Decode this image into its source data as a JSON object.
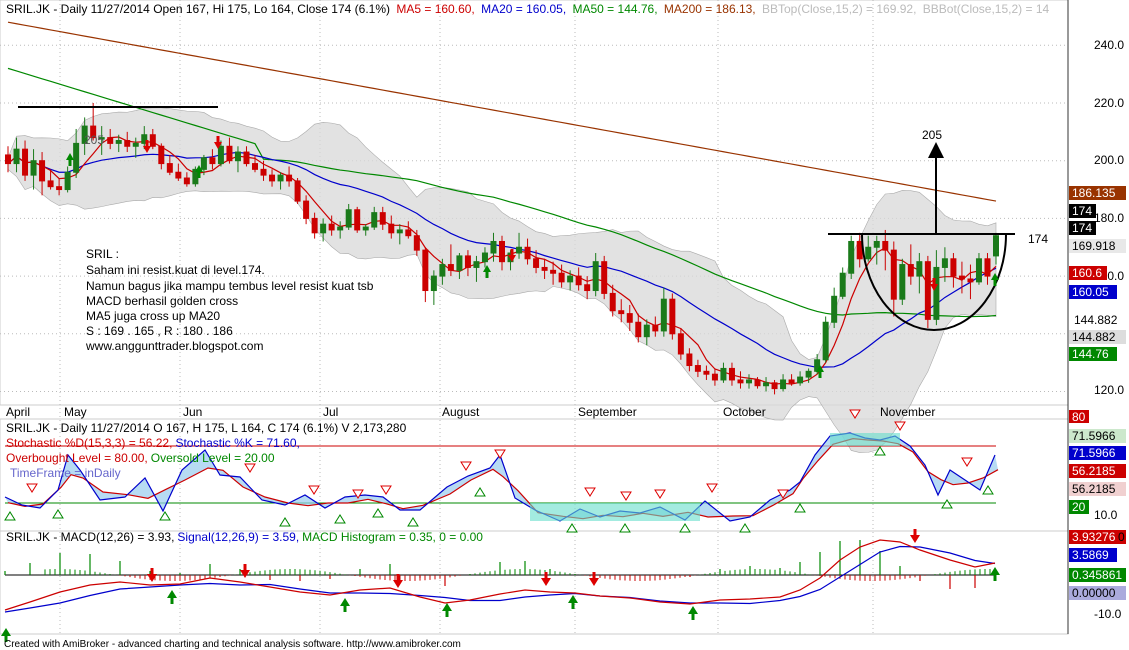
{
  "header": {
    "symbol": "SRIL.JK",
    "desc": " - Daily 11/27/2014 Open 167, Hi 175, Lo 164, Close 174 (6.1%)",
    "ma5": "MA5 = 160.60,",
    "ma20": "MA20 = 160.05,",
    "ma50": "MA50 = 144.76,",
    "ma200": "MA200 = 186.13,",
    "bbtop": "BBTop(Close,15,2) = 169.92,",
    "bbbot": "BBBot(Close,15,2) = 14"
  },
  "colors": {
    "up": "#1a7a1a",
    "down": "#cc0000",
    "ma5": "#cc0000",
    "ma20": "#0000cc",
    "ma50": "#008800",
    "ma200": "#993300",
    "band": "#d8d8d8",
    "histo": "#aaaaaa"
  },
  "price_axis": {
    "ticks": [
      "240.0",
      "220.0",
      "200.0",
      "180.0",
      "160.0",
      "144.882",
      "120.0"
    ],
    "tags": [
      "186.135",
      "174",
      "174",
      "169.918",
      "160.6",
      "160.05",
      "144.882",
      "144.76"
    ]
  },
  "months": [
    "April",
    "May",
    "Jun",
    "Jul",
    "August",
    "September",
    "October",
    "November"
  ],
  "annotations": {
    "resist_label": "205",
    "resist_low": "174",
    "old_top": "205",
    "note_lines": [
      "SRIL :",
      "Saham ini resist.kuat di level.174.",
      "Namun bagus jika mampu tembus level resist kuat tsb",
      "MACD berhasil golden cross",
      "MA5 juga cross up MA20",
      "S : 169 . 165 , R : 180 . 186",
      "www.anggunttrader.blogspot.com"
    ]
  },
  "stoch": {
    "header1": "SRIL.JK - Daily 11/27/2014 O 167, H 175, L 164, C 174 (6.1%) V 2,173,280",
    "d_label": "Stochastic %D(15,3,3) = 56.22,",
    "k_label": "Stochastic %K = 71.60,",
    "ob_label": "Overbought Level = 80.00,",
    "os_label": "Oversold Level = 20.00",
    "tf_label": "TimeFrame = inDaily",
    "ticks": [
      "80",
      "10.0"
    ],
    "tags": [
      "71.5966",
      "71.5966",
      "56.2185",
      "56.2185",
      "20"
    ]
  },
  "macd": {
    "header": "SRIL.JK - MACD(12,26) = 3.93,",
    "signal_label": "Signal(12,26,9) = 3.59,",
    "hist_label": "MACD Histogram = 0.35, 0 = 0.00",
    "ticks": [
      "0",
      "-10.0"
    ],
    "tags": [
      "3.93276",
      "3.5869",
      "0.345861",
      "0.00000"
    ]
  },
  "footer": "Created with AmiBroker - advanced charting and technical analysis software. http://www.amibroker.com",
  "chart_data": {
    "type": "candlestick",
    "title": "SRIL.JK - Daily",
    "ylim": [
      115,
      250
    ],
    "grid": true,
    "candles": [
      [
        202,
        205,
        196,
        199
      ],
      [
        199,
        208,
        196,
        204
      ],
      [
        204,
        207,
        193,
        195
      ],
      [
        195,
        204,
        190,
        200
      ],
      [
        200,
        203,
        188,
        193
      ],
      [
        193,
        197,
        190,
        191
      ],
      [
        191,
        194,
        188,
        190
      ],
      [
        190,
        198,
        189,
        196
      ],
      [
        196,
        211,
        194,
        206
      ],
      [
        206,
        215,
        202,
        212
      ],
      [
        212,
        220,
        207,
        208
      ],
      [
        208,
        212,
        202,
        208
      ],
      [
        208,
        211,
        204,
        206
      ],
      [
        206,
        209,
        203,
        207
      ],
      [
        207,
        210,
        203,
        205
      ],
      [
        205,
        208,
        201,
        206
      ],
      [
        206,
        212,
        204,
        209
      ],
      [
        209,
        211,
        204,
        205
      ],
      [
        205,
        206,
        197,
        199
      ],
      [
        199,
        202,
        195,
        196
      ],
      [
        196,
        199,
        193,
        194
      ],
      [
        194,
        196,
        191,
        192
      ],
      [
        192,
        198,
        191,
        197
      ],
      [
        197,
        202,
        195,
        201
      ],
      [
        201,
        204,
        197,
        199
      ],
      [
        199,
        207,
        198,
        205
      ],
      [
        205,
        208,
        199,
        200
      ],
      [
        200,
        205,
        196,
        203
      ],
      [
        203,
        205,
        198,
        199
      ],
      [
        199,
        202,
        196,
        197
      ],
      [
        197,
        200,
        193,
        195
      ],
      [
        195,
        197,
        191,
        193
      ],
      [
        193,
        196,
        190,
        195
      ],
      [
        195,
        198,
        191,
        193
      ],
      [
        193,
        194,
        185,
        186
      ],
      [
        186,
        188,
        178,
        180
      ],
      [
        180,
        182,
        173,
        175
      ],
      [
        175,
        180,
        172,
        178
      ],
      [
        178,
        181,
        174,
        176
      ],
      [
        176,
        179,
        173,
        177
      ],
      [
        177,
        185,
        176,
        183
      ],
      [
        183,
        184,
        175,
        176
      ],
      [
        176,
        178,
        174,
        177
      ],
      [
        177,
        184,
        176,
        182
      ],
      [
        182,
        184,
        176,
        178
      ],
      [
        178,
        181,
        173,
        175
      ],
      [
        175,
        178,
        171,
        176
      ],
      [
        176,
        179,
        173,
        174
      ],
      [
        174,
        176,
        167,
        169
      ],
      [
        169,
        170,
        151,
        155
      ],
      [
        155,
        162,
        150,
        160
      ],
      [
        160,
        166,
        157,
        164
      ],
      [
        164,
        171,
        160,
        162
      ],
      [
        162,
        168,
        159,
        167
      ],
      [
        167,
        169,
        160,
        163
      ],
      [
        163,
        167,
        158,
        165
      ],
      [
        165,
        170,
        163,
        168
      ],
      [
        168,
        175,
        165,
        172
      ],
      [
        172,
        174,
        162,
        165
      ],
      [
        165,
        169,
        162,
        168
      ],
      [
        168,
        175,
        166,
        170
      ],
      [
        170,
        173,
        164,
        166
      ],
      [
        166,
        169,
        161,
        163
      ],
      [
        163,
        166,
        159,
        162
      ],
      [
        162,
        165,
        157,
        161
      ],
      [
        161,
        164,
        156,
        158
      ],
      [
        158,
        162,
        155,
        160
      ],
      [
        160,
        163,
        155,
        157
      ],
      [
        157,
        160,
        152,
        155
      ],
      [
        155,
        168,
        153,
        165
      ],
      [
        165,
        167,
        152,
        154
      ],
      [
        154,
        157,
        146,
        148
      ],
      [
        148,
        152,
        144,
        147
      ],
      [
        147,
        150,
        141,
        144
      ],
      [
        144,
        147,
        137,
        139
      ],
      [
        139,
        145,
        136,
        143
      ],
      [
        143,
        146,
        139,
        141
      ],
      [
        141,
        156,
        139,
        152
      ],
      [
        152,
        154,
        138,
        140
      ],
      [
        140,
        142,
        131,
        133
      ],
      [
        133,
        135,
        127,
        129
      ],
      [
        129,
        131,
        125,
        127
      ],
      [
        127,
        129,
        124,
        126
      ],
      [
        126,
        128,
        122,
        124
      ],
      [
        124,
        130,
        123,
        128
      ],
      [
        128,
        130,
        122,
        124
      ],
      [
        124,
        127,
        121,
        123
      ],
      [
        123,
        126,
        121,
        124
      ],
      [
        124,
        125,
        121,
        122
      ],
      [
        122,
        125,
        120,
        123
      ],
      [
        123,
        124,
        119,
        121
      ],
      [
        121,
        126,
        120,
        124
      ],
      [
        124,
        126,
        122,
        123
      ],
      [
        123,
        127,
        122,
        125
      ],
      [
        125,
        128,
        123,
        127
      ],
      [
        127,
        133,
        126,
        131
      ],
      [
        131,
        146,
        130,
        144
      ],
      [
        144,
        156,
        142,
        153
      ],
      [
        153,
        163,
        152,
        161
      ],
      [
        161,
        174,
        159,
        172
      ],
      [
        172,
        175,
        163,
        166
      ],
      [
        166,
        174,
        165,
        170
      ],
      [
        170,
        174,
        164,
        172
      ],
      [
        172,
        176,
        162,
        169
      ],
      [
        169,
        172,
        146,
        152
      ],
      [
        152,
        166,
        150,
        164
      ],
      [
        164,
        171,
        157,
        160
      ],
      [
        160,
        168,
        154,
        165
      ],
      [
        165,
        167,
        142,
        145
      ],
      [
        145,
        169,
        143,
        163
      ],
      [
        163,
        170,
        158,
        166
      ],
      [
        166,
        168,
        156,
        160
      ],
      [
        160,
        165,
        154,
        159
      ],
      [
        159,
        164,
        152,
        158
      ],
      [
        158,
        168,
        157,
        166
      ],
      [
        166,
        168,
        157,
        160
      ],
      [
        167,
        175,
        164,
        174
      ]
    ],
    "ma5_last": 160.6,
    "ma20_last": 160.05,
    "ma50_last": 144.76,
    "ma200_last": 186.13,
    "bb_top_last": 169.92,
    "resistance": 174,
    "target": 205,
    "stochastic": {
      "d": 56.22,
      "k": 71.6,
      "overbought": 80,
      "oversold": 20
    },
    "macd": {
      "macd": 3.93,
      "signal": 3.59,
      "histogram": 0.35
    }
  }
}
